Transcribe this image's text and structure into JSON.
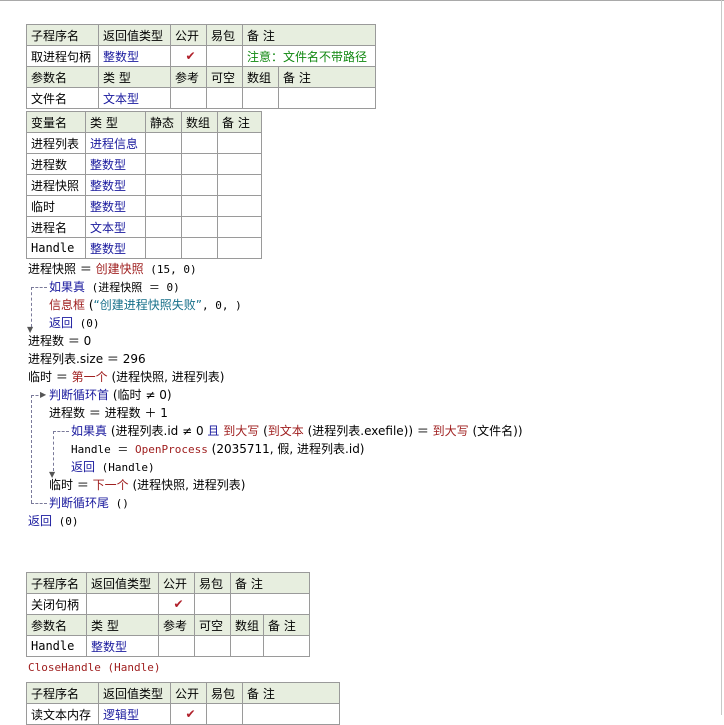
{
  "sub1": {
    "header": [
      "子程序名",
      "返回值类型",
      "公开",
      "易包",
      "备 注"
    ],
    "name": "取进程句柄",
    "return_type": "整数型",
    "public_mark": "✔",
    "note": "注意：文件名不带路径",
    "param_header": [
      "参数名",
      "类 型",
      "参考",
      "可空",
      "数组",
      "备 注"
    ],
    "params": [
      {
        "name": "文件名",
        "type": "文本型"
      }
    ]
  },
  "vars": {
    "header": [
      "变量名",
      "类 型",
      "静态",
      "数组",
      "备 注"
    ],
    "rows": [
      {
        "name": "进程列表",
        "type": "进程信息"
      },
      {
        "name": "进程数",
        "type": "整数型"
      },
      {
        "name": "进程快照",
        "type": "整数型"
      },
      {
        "name": "临时",
        "type": "整数型"
      },
      {
        "name": "进程名",
        "type": "文本型"
      },
      {
        "name": "Handle",
        "type": "整数型"
      }
    ]
  },
  "code1": {
    "l1": {
      "a": "进程快照 ＝ ",
      "f": "创建快照",
      "b": " (15, 0)"
    },
    "l2": {
      "k": "如果真",
      "b": " (进程快照 ＝ 0)"
    },
    "l3": {
      "f": "信息框",
      "b": " (",
      "s": "“创建进程快照失败”",
      "c": ", 0, )"
    },
    "l4": {
      "k": "返回",
      "b": " (0)"
    },
    "l5": "进程数 ＝ 0",
    "l6": "进程列表.size ＝ 296",
    "l7": {
      "a": "临时 ＝ ",
      "f": "第一个",
      "b": " (进程快照, 进程列表)"
    },
    "l8": {
      "k": "判断循环首",
      "b": " (临时 ≠ 0)"
    },
    "l9": "进程数 ＝ 进程数 ＋ 1",
    "l10": {
      "k": "如果真",
      "b": " (进程列表.id ≠ 0 ",
      "k2": "且",
      "f": " 到大写",
      "b2": " (",
      "f2": "到文本",
      "b3": " (进程列表.exefile)) ＝ ",
      "f3": "到大写",
      "b4": " (文件名))"
    },
    "l11": {
      "a": "Handle ＝ ",
      "f": "OpenProcess",
      "b": " (2035711, 假, 进程列表.id)"
    },
    "l12": {
      "k": "返回",
      "b": " (Handle)"
    },
    "l13": {
      "a": "临时 ＝ ",
      "f": "下一个",
      "b": " (进程快照, 进程列表)"
    },
    "l14": {
      "k": "判断循环尾",
      "b": " ()"
    },
    "l15": {
      "k": "返回",
      "b": " (0)"
    }
  },
  "sub2": {
    "header": [
      "子程序名",
      "返回值类型",
      "公开",
      "易包",
      "备 注"
    ],
    "name": "关闭句柄",
    "return_type": "",
    "public_mark": "✔",
    "param_header": [
      "参数名",
      "类 型",
      "参考",
      "可空",
      "数组",
      "备 注"
    ],
    "params": [
      {
        "name": "Handle",
        "type": "整数型"
      }
    ],
    "code": "CloseHandle (Handle)"
  },
  "sub3": {
    "header": [
      "子程序名",
      "返回值类型",
      "公开",
      "易包",
      "备 注"
    ],
    "name": "读文本内存",
    "return_type": "逻辑型",
    "public_mark": "✔"
  }
}
